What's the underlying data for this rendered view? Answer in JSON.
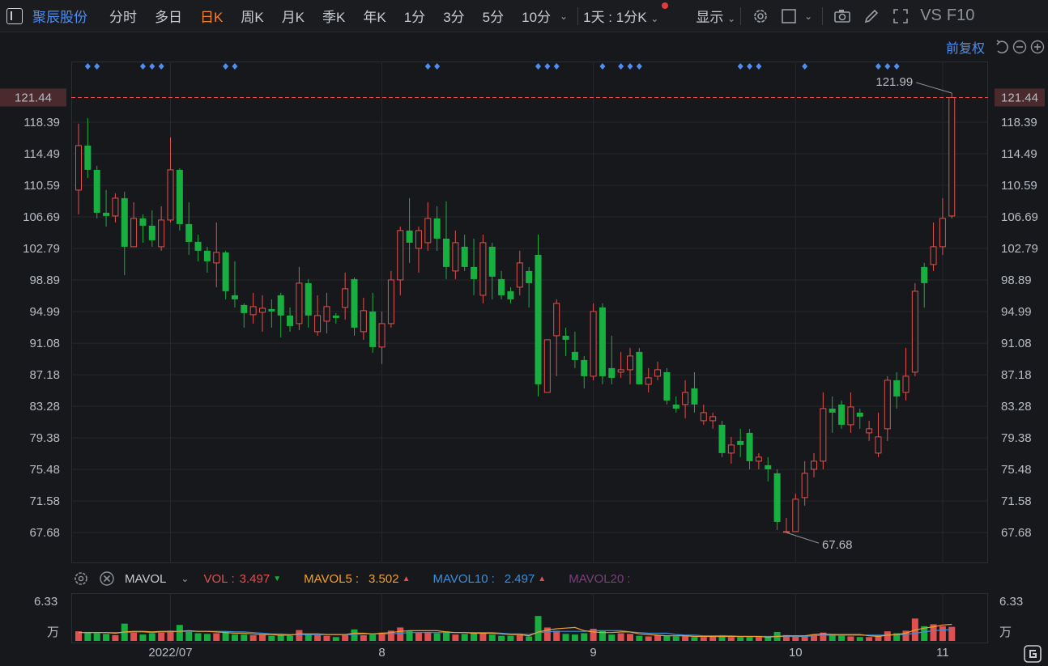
{
  "toolbar": {
    "stock_name": "聚辰股份",
    "tabs": [
      "分时",
      "多日",
      "日K",
      "周K",
      "月K",
      "季K",
      "年K",
      "1分",
      "3分",
      "5分",
      "10分"
    ],
    "active_tab": "日K",
    "interval": "1天 : 1分K",
    "display": "显示",
    "vs": "VS",
    "f10": "F10",
    "icons": [
      "gear-icon",
      "checkbox-icon",
      "camera-icon",
      "pencil-icon",
      "fullscreen-icon"
    ]
  },
  "adjust": {
    "label": "前复权",
    "icons": [
      "undo-icon",
      "zoom-out-icon",
      "zoom-in-icon"
    ]
  },
  "colors": {
    "up": "#e0504e",
    "down": "#17b040",
    "accent": "#4c8ef7",
    "active_tab": "#f5832c",
    "ma5": "#f0a030",
    "ma10": "#3a8fd8",
    "ma20": "#7b3f7b"
  },
  "chart_data": {
    "type": "candlestick",
    "y_ticks": [
      "118.39",
      "114.49",
      "110.59",
      "106.69",
      "102.79",
      "98.89",
      "94.99",
      "91.08",
      "87.18",
      "83.28",
      "79.38",
      "75.48",
      "71.58",
      "67.68"
    ],
    "ylim": [
      67.68,
      121.99
    ],
    "x_labels": [
      "2022/07",
      "8",
      "9",
      "10",
      "11"
    ],
    "current_price": "121.44",
    "high_label": "121.99",
    "low_label": "67.68",
    "candles": [
      [
        110.0,
        115.5,
        107.0,
        118.2
      ],
      [
        115.5,
        112.5,
        111.5,
        118.9
      ],
      [
        112.5,
        107.2,
        106.5,
        113.0
      ],
      [
        107.2,
        106.8,
        105.5,
        110.0
      ],
      [
        106.8,
        109.0,
        106.0,
        109.6
      ],
      [
        109.0,
        103.0,
        99.5,
        109.8
      ],
      [
        103.0,
        106.5,
        103.0,
        108.5
      ],
      [
        106.5,
        105.6,
        103.5,
        107.0
      ],
      [
        105.6,
        103.8,
        103.0,
        107.5
      ],
      [
        103.0,
        106.3,
        102.5,
        108.0
      ],
      [
        106.3,
        112.5,
        106.0,
        116.5
      ],
      [
        112.5,
        105.8,
        105.0,
        112.7
      ],
      [
        105.8,
        103.6,
        102.0,
        108.5
      ],
      [
        103.6,
        102.5,
        101.2,
        104.5
      ],
      [
        102.5,
        101.2,
        99.8,
        103.0
      ],
      [
        101.0,
        102.3,
        98.0,
        106.0
      ],
      [
        102.3,
        97.5,
        96.5,
        102.5
      ],
      [
        97.0,
        96.5,
        95.5,
        101.2
      ],
      [
        95.8,
        94.8,
        93.0,
        96.0
      ],
      [
        94.6,
        95.6,
        93.5,
        97.3
      ],
      [
        94.9,
        95.4,
        92.5,
        97.0
      ],
      [
        95.3,
        95.0,
        93.0,
        96.5
      ],
      [
        97.0,
        94.5,
        91.8,
        97.3
      ],
      [
        94.5,
        93.2,
        92.5,
        95.5
      ],
      [
        93.5,
        98.5,
        92.7,
        100.5
      ],
      [
        98.5,
        94.5,
        93.0,
        99.0
      ],
      [
        92.5,
        94.5,
        92.0,
        97.0
      ],
      [
        93.8,
        95.6,
        92.3,
        97.3
      ],
      [
        94.5,
        94.2,
        93.5,
        94.8
      ],
      [
        95.5,
        97.8,
        94.0,
        99.8
      ],
      [
        99.0,
        93.0,
        92.0,
        99.2
      ],
      [
        92.5,
        95.1,
        91.5,
        96.7
      ],
      [
        95.0,
        90.6,
        89.9,
        97.3
      ],
      [
        90.6,
        93.5,
        88.5,
        95.0
      ],
      [
        93.5,
        98.9,
        93.0,
        100.0
      ],
      [
        98.9,
        105.0,
        97.0,
        105.5
      ],
      [
        105.0,
        103.5,
        101.0,
        109.0
      ],
      [
        102.8,
        105.0,
        99.8,
        105.5
      ],
      [
        103.5,
        106.5,
        102.5,
        108.5
      ],
      [
        106.5,
        104.0,
        102.5,
        108.0
      ],
      [
        104.0,
        100.5,
        99.0,
        108.6
      ],
      [
        100.0,
        103.5,
        99.0,
        105.0
      ],
      [
        103.0,
        100.5,
        100.0,
        104.5
      ],
      [
        100.5,
        99.0,
        97.0,
        104.0
      ],
      [
        97.0,
        103.5,
        96.0,
        104.5
      ],
      [
        103.0,
        99.3,
        96.5,
        103.5
      ],
      [
        99.0,
        97.0,
        96.5,
        100.0
      ],
      [
        97.5,
        96.5,
        96.0,
        98.0
      ],
      [
        98.0,
        101.0,
        97.0,
        102.5
      ],
      [
        100.0,
        98.5,
        95.5,
        100.5
      ],
      [
        102.0,
        86.0,
        84.5,
        104.5
      ],
      [
        85.0,
        91.5,
        85.0,
        91.5
      ],
      [
        92.0,
        96.0,
        87.0,
        96.5
      ],
      [
        92.0,
        91.5,
        89.5,
        93.0
      ],
      [
        90.0,
        89.0,
        88.0,
        92.5
      ],
      [
        89.0,
        87.0,
        85.5,
        89.5
      ],
      [
        87.0,
        95.0,
        86.5,
        96.0
      ],
      [
        95.5,
        87.0,
        86.0,
        96.0
      ],
      [
        88.0,
        86.8,
        86.0,
        92.0
      ],
      [
        87.5,
        87.8,
        86.8,
        90.0
      ],
      [
        87.8,
        89.5,
        86.0,
        90.5
      ],
      [
        90.0,
        86.0,
        86.2,
        90.5
      ],
      [
        86.0,
        86.8,
        85.0,
        88.0
      ],
      [
        87.0,
        87.8,
        86.5,
        88.8
      ],
      [
        87.5,
        84.0,
        83.5,
        88.0
      ],
      [
        83.5,
        83.0,
        82.5,
        84.5
      ],
      [
        83.5,
        85.0,
        81.8,
        86.5
      ],
      [
        85.5,
        83.5,
        82.5,
        87.5
      ],
      [
        81.5,
        82.5,
        81.0,
        83.5
      ],
      [
        81.5,
        82.0,
        80.5,
        82.5
      ],
      [
        81.0,
        77.5,
        77.0,
        81.5
      ],
      [
        77.5,
        78.5,
        76.2,
        79.5
      ],
      [
        79.0,
        78.5,
        77.0,
        80.5
      ],
      [
        80.0,
        76.5,
        75.5,
        80.5
      ],
      [
        76.5,
        77.0,
        75.5,
        77.5
      ],
      [
        76.0,
        75.5,
        74.0,
        77.0
      ],
      [
        75.0,
        69.0,
        68.0,
        75.5
      ],
      [
        67.8,
        67.8,
        67.7,
        69.5
      ],
      [
        67.8,
        71.8,
        67.8,
        72.5
      ],
      [
        72.0,
        75.0,
        71.0,
        76.5
      ],
      [
        75.5,
        76.5,
        74.5,
        77.5
      ],
      [
        76.5,
        83.0,
        75.5,
        85.0
      ],
      [
        83.0,
        82.5,
        80.0,
        84.5
      ],
      [
        83.5,
        81.0,
        80.5,
        84.0
      ],
      [
        81.0,
        83.2,
        80.0,
        85.0
      ],
      [
        82.5,
        82.0,
        80.5,
        83.0
      ],
      [
        80.0,
        80.5,
        79.0,
        81.5
      ],
      [
        77.5,
        79.5,
        77.0,
        82.5
      ],
      [
        80.5,
        86.5,
        79.0,
        87.0
      ],
      [
        86.5,
        84.5,
        83.0,
        87.5
      ],
      [
        85.0,
        87.0,
        84.0,
        90.5
      ],
      [
        87.5,
        97.5,
        87.0,
        98.5
      ],
      [
        100.5,
        98.5,
        95.5,
        101.0
      ],
      [
        100.8,
        103.0,
        100.0,
        106.0
      ],
      [
        103.0,
        106.5,
        102.0,
        109.0
      ],
      [
        106.8,
        121.44,
        106.5,
        121.99
      ]
    ],
    "volume": {
      "label": "MAVOL",
      "series": [
        {
          "name": "VOL",
          "value": "3.497",
          "trend": "down"
        },
        {
          "name": "MAVOL5",
          "value": "3.502",
          "trend": "up"
        },
        {
          "name": "MAVOL10",
          "value": "2.497",
          "trend": "up"
        },
        {
          "name": "MAVOL20",
          "value": ""
        }
      ],
      "y_top": "6.33",
      "unit": "万",
      "ylim": [
        0,
        6.33
      ],
      "values": [
        1.5,
        1.4,
        1.2,
        1.1,
        0.9,
        2.7,
        1.3,
        1.0,
        1.2,
        1.3,
        1.6,
        2.5,
        1.4,
        1.2,
        1.1,
        1.2,
        1.5,
        1.0,
        1.0,
        0.9,
        1.0,
        0.8,
        1.0,
        0.8,
        1.7,
        1.0,
        0.9,
        0.8,
        0.6,
        0.9,
        1.8,
        0.9,
        1.0,
        1.3,
        1.6,
        2.1,
        1.5,
        1.3,
        1.4,
        1.2,
        1.5,
        1.0,
        1.1,
        1.2,
        1.3,
        1.0,
        0.8,
        0.8,
        0.9,
        0.7,
        3.9,
        2.1,
        1.6,
        1.1,
        1.0,
        1.2,
        1.9,
        1.6,
        1.0,
        1.2,
        1.1,
        0.8,
        0.7,
        0.9,
        0.8,
        0.7,
        0.8,
        0.6,
        0.6,
        0.7,
        0.9,
        0.6,
        0.6,
        0.6,
        0.6,
        0.7,
        1.4,
        0.9,
        0.7,
        0.8,
        1.0,
        1.3,
        1.1,
        0.8,
        0.7,
        0.6,
        0.6,
        0.9,
        1.5,
        1.2,
        1.6,
        3.5,
        2.3,
        2.6,
        2.3,
        2.2
      ],
      "ma5": [
        1.3,
        1.3,
        1.3,
        1.3,
        1.2,
        1.4,
        1.5,
        1.5,
        1.4,
        1.5,
        1.5,
        1.5,
        1.6,
        1.5,
        1.5,
        1.4,
        1.3,
        1.2,
        1.2,
        1.1,
        1.0,
        1.0,
        0.9,
        0.9,
        1.1,
        1.1,
        1.1,
        1.0,
        1.0,
        1.0,
        1.2,
        1.2,
        1.1,
        1.2,
        1.3,
        1.5,
        1.6,
        1.6,
        1.6,
        1.6,
        1.4,
        1.3,
        1.3,
        1.2,
        1.2,
        1.2,
        1.1,
        1.0,
        1.0,
        0.8,
        1.4,
        1.7,
        1.9,
        2.0,
        2.1,
        1.6,
        1.4,
        1.3,
        1.3,
        1.4,
        1.4,
        1.1,
        1.0,
        0.9,
        0.8,
        0.8,
        0.8,
        0.7,
        0.7,
        0.7,
        0.7,
        0.7,
        0.7,
        0.7,
        0.7,
        0.6,
        0.7,
        0.8,
        0.8,
        0.8,
        1.0,
        1.1,
        1.0,
        1.0,
        1.0,
        1.0,
        0.8,
        0.7,
        0.9,
        1.0,
        1.2,
        1.7,
        2.0,
        2.2,
        2.5,
        2.6
      ],
      "ma10": [
        1.3,
        1.3,
        1.3,
        1.3,
        1.3,
        1.3,
        1.4,
        1.4,
        1.3,
        1.4,
        1.4,
        1.5,
        1.5,
        1.5,
        1.5,
        1.5,
        1.5,
        1.4,
        1.4,
        1.3,
        1.2,
        1.1,
        1.1,
        1.0,
        1.0,
        1.0,
        1.0,
        1.0,
        1.0,
        1.0,
        1.0,
        1.1,
        1.1,
        1.1,
        1.1,
        1.2,
        1.3,
        1.3,
        1.3,
        1.3,
        1.3,
        1.3,
        1.3,
        1.3,
        1.3,
        1.3,
        1.2,
        1.1,
        1.1,
        1.0,
        1.3,
        1.4,
        1.5,
        1.5,
        1.5,
        1.5,
        1.6,
        1.6,
        1.6,
        1.6,
        1.4,
        1.3,
        1.2,
        1.2,
        1.2,
        1.0,
        0.9,
        0.9,
        0.8,
        0.8,
        0.8,
        0.8,
        0.7,
        0.7,
        0.7,
        0.7,
        0.7,
        0.7,
        0.7,
        0.7,
        0.8,
        0.9,
        0.9,
        0.9,
        0.9,
        0.9,
        0.9,
        0.9,
        0.9,
        1.0,
        1.0,
        1.2,
        1.4,
        1.6,
        1.7,
        1.8
      ]
    },
    "markers": [
      1,
      2,
      7,
      8,
      9,
      16,
      17,
      38,
      39,
      50,
      51,
      52,
      57,
      59,
      60,
      61,
      72,
      73,
      74,
      79,
      87,
      88,
      89
    ]
  }
}
